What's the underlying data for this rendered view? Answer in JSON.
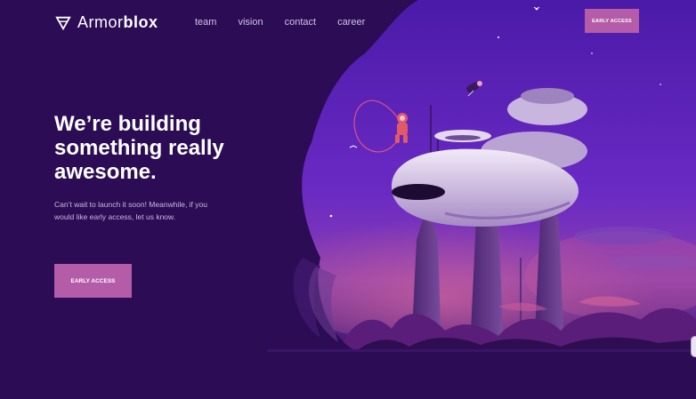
{
  "brand": {
    "light": "Armor",
    "bold": "blox"
  },
  "nav": {
    "links": [
      "team",
      "vision",
      "contact",
      "career"
    ],
    "cta_label": "EARLY ACCESS"
  },
  "hero": {
    "title_line1": "We’re building",
    "title_line2": "something really",
    "title_line3": "awesome.",
    "subtitle": "Can’t wait to launch it soon! Meanwhile, if you would like early access, let us know.",
    "cta_label": "EARLY ACCESS"
  },
  "colors": {
    "background": "#2b0c55",
    "accent": "#b45ca8",
    "sky": "#5a22b8"
  },
  "icons": [
    "logo-shield-icon"
  ]
}
